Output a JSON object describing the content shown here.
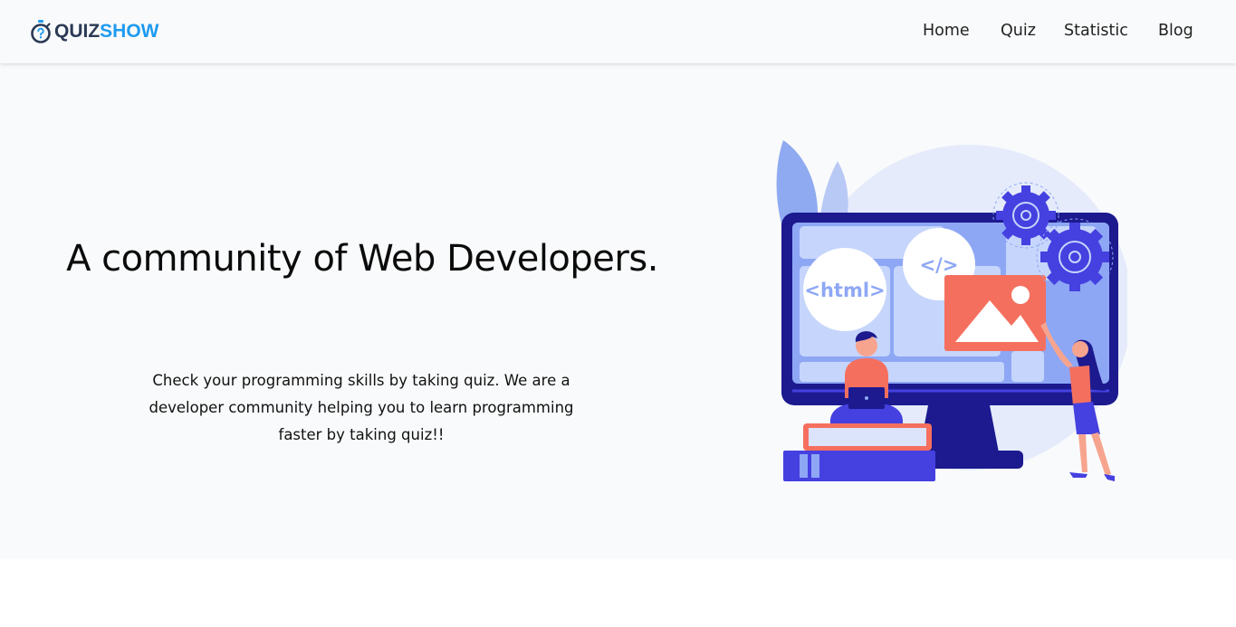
{
  "brand": {
    "name_part1": "QUIZ",
    "name_part2": "SHOW",
    "icon": "stopwatch-question-icon"
  },
  "nav": {
    "items": [
      {
        "label": "Home"
      },
      {
        "label": "Quiz"
      },
      {
        "label": "Statistic"
      },
      {
        "label": "Blog"
      }
    ]
  },
  "hero": {
    "title": "A community of Web Developers.",
    "subtitle": "Check your programming skills by taking quiz. We are a developer community helping you to learn programming faster by taking quiz!!",
    "illustration_labels": {
      "html_tag": "<html>",
      "code_tag": "</>"
    }
  },
  "colors": {
    "brand_dark": "#2b3a55",
    "brand_blue": "#1e9bf0",
    "accent_indigo": "#4540e0",
    "accent_coral": "#f56f5e",
    "hero_bg": "#f9fafb"
  }
}
